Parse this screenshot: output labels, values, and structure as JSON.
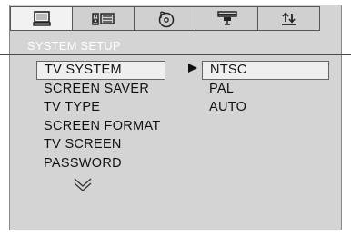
{
  "header": {
    "tabs": [
      {
        "icon": "monitor-icon"
      },
      {
        "icon": "speaker-screen-icon"
      },
      {
        "icon": "disc-icon"
      },
      {
        "icon": "projector-icon"
      },
      {
        "icon": "sort-arrows-icon"
      }
    ],
    "active_tab": 0,
    "title": "SYSTEM SETUP"
  },
  "menu": {
    "items": [
      "TV SYSTEM",
      "SCREEN SAVER",
      "TV TYPE",
      "SCREEN FORMAT",
      "TV SCREEN",
      "PASSWORD"
    ],
    "selected_index": 0,
    "more_icon": "chevron-down-icon"
  },
  "options": {
    "arrow_icon": "right-triangle-icon",
    "items": [
      "NTSC",
      "PAL",
      "AUTO"
    ],
    "selected_index": 0
  },
  "colors": {
    "background": "#d4d4d4",
    "title_text": "#ffffff",
    "highlight": "#efefef"
  }
}
